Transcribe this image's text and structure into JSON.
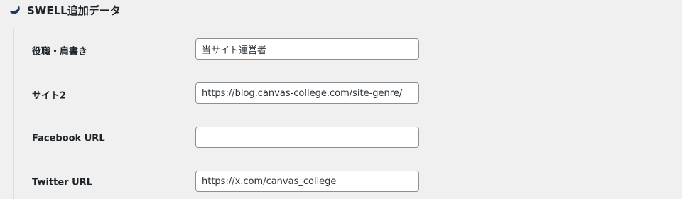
{
  "section": {
    "title": "SWELL追加データ",
    "icon": "swell-logo-icon"
  },
  "fields": [
    {
      "label": "役職・肩書き",
      "value": "当サイト運営者"
    },
    {
      "label": "サイト2",
      "value": "https://blog.canvas-college.com/site-genre/"
    },
    {
      "label": "Facebook URL",
      "value": ""
    },
    {
      "label": "Twitter URL",
      "value": "https://x.com/canvas_college"
    }
  ],
  "colors": {
    "page_background": "#f0f0f1",
    "input_border": "#8c8f94",
    "logo": "#1f3b57"
  }
}
